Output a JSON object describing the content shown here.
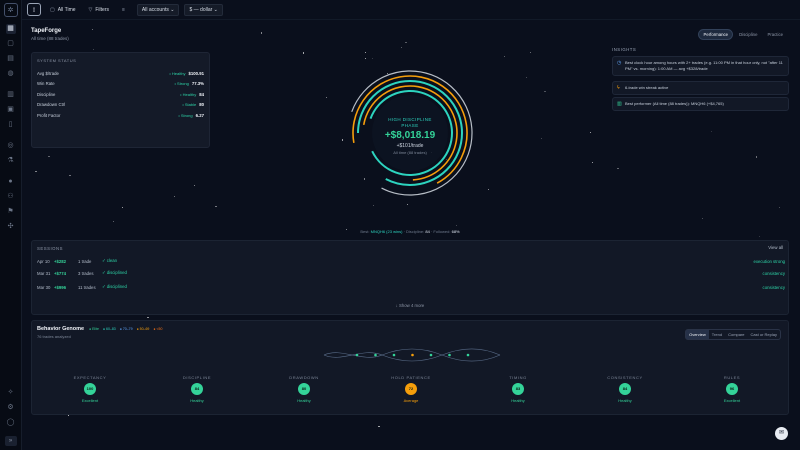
{
  "colors": {
    "accent": "#34d399",
    "teal": "#2dd4bf",
    "orange": "#f59e0b",
    "bg": "#0a0f1c",
    "panel": "#121826"
  },
  "topbar": {
    "range_label": "All Time",
    "filters_label": "Filters",
    "accounts_label": "All accounts",
    "currency_label": "$ — dollar"
  },
  "header": {
    "title": "TapeForge",
    "subtitle": "All time (88 trades)"
  },
  "status": {
    "label": "SYSTEM STATUS",
    "rows": [
      {
        "name": "Avg $/trade",
        "tag": "• Healthy",
        "value": "$100.91"
      },
      {
        "name": "Win Rate",
        "tag": "• Strong",
        "value": "77.3%"
      },
      {
        "name": "Discipline",
        "tag": "• Healthy",
        "value": "84"
      },
      {
        "name": "Drawdown Ctrl",
        "tag": "• Stable",
        "value": "80"
      },
      {
        "name": "Profit Factor",
        "tag": "• Strong",
        "value": "6.27"
      }
    ]
  },
  "hero": {
    "phase_line1": "HIGH DISCIPLINE",
    "phase_line2": "PHASE",
    "pnl": "+$8,018.19",
    "per_trade": "+$101/trade",
    "all_time": "All time (88 trades)"
  },
  "best": {
    "label": "Best:",
    "symbol": "MNQH6 (23 wins)",
    "disc_label": "Discipline:",
    "disc_val": "84",
    "follow_label": "Followed:",
    "follow_val": "68%"
  },
  "tabs": [
    "Performance",
    "Discipline",
    "Practice"
  ],
  "insights": {
    "label": "INSIGHTS",
    "items": [
      {
        "icon": "clock-icon",
        "text": "Best clock hour among hours with 2+ trades (e.g. 11:00 PM in that hour only, not \"after 11 PM\" vs. morning): 1:00 AM — avg +$328/trade"
      },
      {
        "icon": "bolt-icon",
        "text": "6-trade win streak active"
      },
      {
        "icon": "chart-icon",
        "text": "Best performer (All time (88 trades)): MNQH6 (+$4,765)"
      }
    ]
  },
  "sessions": {
    "label": "SESSIONS",
    "view_all": "View all",
    "rows": [
      {
        "date": "Apr 10",
        "pnl": "+$282",
        "trades": "1 trade",
        "status": "✓ clean",
        "tag": "execution strong"
      },
      {
        "date": "Mar 31",
        "pnl": "+$774",
        "trades": "3 trades",
        "status": "✓ disciplined",
        "tag": "consistency"
      },
      {
        "date": "Mar 30",
        "pnl": "+$996",
        "trades": "11 trades",
        "status": "✓ disciplined",
        "tag": "consistency"
      }
    ],
    "show_more": "↓ Show 4 more"
  },
  "genome": {
    "title": "Behavior Genome",
    "subtitle": "76 trades analyzed",
    "legend": [
      "● Elite",
      "● 60–83",
      "● 70–79",
      "● 50–69",
      "● <50"
    ],
    "tabs": [
      "Overview",
      "Trend",
      "Compare",
      "Cast or Replay"
    ],
    "metrics": [
      {
        "name": "EXPECTANCY",
        "score": "100",
        "status": "Excellent",
        "color": "#34d399"
      },
      {
        "name": "DISCIPLINE",
        "score": "84",
        "status": "Healthy",
        "color": "#34d399"
      },
      {
        "name": "DRAWDOWN",
        "score": "80",
        "status": "Healthy",
        "color": "#34d399"
      },
      {
        "name": "HOLD PATIENCE",
        "score": "72",
        "status": "Average",
        "color": "#f59e0b"
      },
      {
        "name": "TIMING",
        "score": "83",
        "status": "Healthy",
        "color": "#34d399"
      },
      {
        "name": "CONSISTENCY",
        "score": "84",
        "status": "Healthy",
        "color": "#34d399"
      },
      {
        "name": "RULES",
        "score": "96",
        "status": "Excellent",
        "color": "#34d399"
      }
    ]
  }
}
